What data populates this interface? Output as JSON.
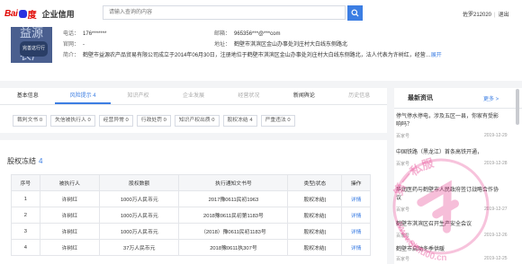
{
  "header": {
    "brand_bai": "Bai",
    "brand_du": "度",
    "brand_sub": "企业信用",
    "search_placeholder": "请输入查询的内容",
    "user_name": "佐罗212020",
    "logout": "退出"
  },
  "company": {
    "avatar_top": "益源",
    "avatar_bottom": "农产",
    "claim_label": "完善这行行",
    "phone_label": "电话：",
    "phone": "176*******",
    "email_label": "邮箱：",
    "email": "965356***@***com",
    "website_label": "官网：",
    "website": "-",
    "address_label": "地址：",
    "address": "鹤壁市淇滨区金山办事处刘庄村大白线东侧路北",
    "intro_label": "简介：",
    "intro": "鹤壁市益源农产品贸易有限公司成立于2014年06月30日，注册地位于鹤壁市淇滨区金山办事处刘庄村大白线东侧路北，法人代表为许树红，经营…",
    "intro_more": "展开"
  },
  "tabs": [
    {
      "label": "基本信息",
      "count": ""
    },
    {
      "label": "风险提示",
      "count": "4"
    },
    {
      "label": "知识产权",
      "count": ""
    },
    {
      "label": "企业发展",
      "count": ""
    },
    {
      "label": "经营状况",
      "count": ""
    },
    {
      "label": "新闻舆论",
      "count": ""
    },
    {
      "label": "历史信息",
      "count": ""
    }
  ],
  "subtabs": [
    {
      "label": "裁判文书",
      "count": "0"
    },
    {
      "label": "失信被执行人",
      "count": "0"
    },
    {
      "label": "经营异常",
      "count": "0"
    },
    {
      "label": "行政处罚",
      "count": "0"
    },
    {
      "label": "知识产权出质",
      "count": "0"
    },
    {
      "label": "股权冻结",
      "count": "4"
    },
    {
      "label": "严重违法",
      "count": "0"
    }
  ],
  "section": {
    "title": "股权冻结",
    "count": "4"
  },
  "table": {
    "headers": [
      "序号",
      "被执行人",
      "股权数额",
      "执行通知文书号",
      "类型|状态",
      "操作"
    ],
    "rows": [
      [
        "1",
        "许树红",
        "1000万人民币元",
        "2017豫0611民初1963",
        "股权冻结|",
        "详情"
      ],
      [
        "2",
        "许树红",
        "1000万人民币元",
        "2018豫0611民初第1183号",
        "股权冻结|",
        "详情"
      ],
      [
        "3",
        "许树红",
        "1000万人民币元",
        "（2018）豫0611民初1183号",
        "股权冻结|",
        "详情"
      ],
      [
        "4",
        "许树红",
        "37万人民币元",
        "2018豫0611执307号",
        "股权冻结|",
        "详情"
      ]
    ]
  },
  "side": {
    "title": "最新资讯",
    "more": "更多 >",
    "news": [
      {
        "title": "停气停水停电，涉及五区一县，你家有受影响吗？",
        "source": "百家号",
        "date": "2019-12-29"
      },
      {
        "title": "中国铁路（黑龙江）首条高铁开通，",
        "source": "百家号",
        "date": "2019-12-28"
      },
      {
        "title": "华润医药与鹤壁市人民政府签订战略合作协议",
        "source": "百家号",
        "date": "2019-12-27"
      },
      {
        "title": "鹤壁市淇滨区召开生产安全会议",
        "source": "百家号",
        "date": "2019-12-26"
      },
      {
        "title": "鹤壁市启动冬季供暖",
        "source": "百家号",
        "date": "2019-12-25"
      }
    ]
  },
  "watermark": {
    "text": "第一私服",
    "url": "www.SiMu00.cn"
  }
}
